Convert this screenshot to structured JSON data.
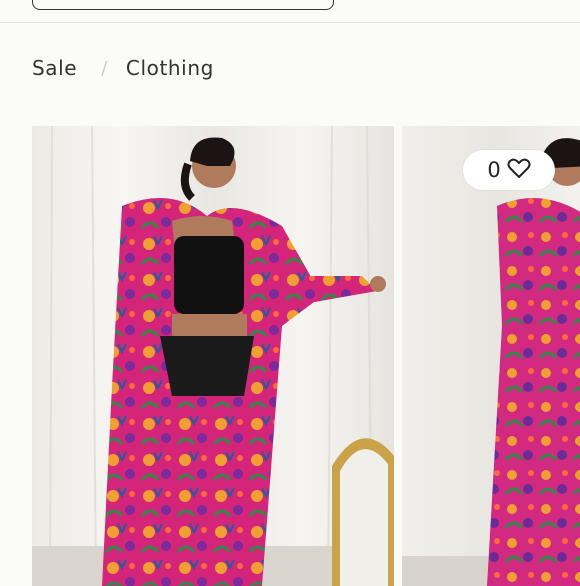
{
  "breadcrumb": {
    "items": [
      "Sale",
      "Clothing"
    ],
    "separator": "/"
  },
  "wishlist": {
    "count": "0",
    "icon": "heart-icon"
  },
  "gallery": {
    "images": [
      {
        "subject": "model-robe-front"
      },
      {
        "subject": "model-robe-back"
      }
    ]
  },
  "colors": {
    "background": "#fbfbf7",
    "robe_primary": "#d4257a",
    "robe_accent": "#f0a030",
    "text": "#333333"
  }
}
